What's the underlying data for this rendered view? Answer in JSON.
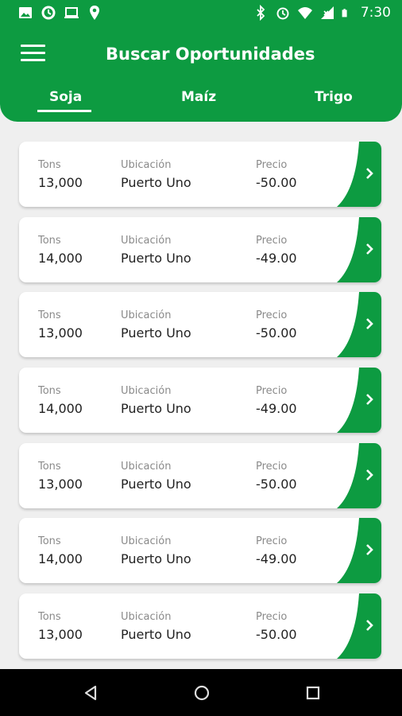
{
  "status_bar": {
    "time": "7:30"
  },
  "header": {
    "title": "Buscar Oportunidades"
  },
  "tabs": [
    {
      "label": "Soja",
      "active": true
    },
    {
      "label": "Maíz",
      "active": false
    },
    {
      "label": "Trigo",
      "active": false
    }
  ],
  "columns": {
    "tons": "Tons",
    "location": "Ubicación",
    "price": "Precio"
  },
  "cards": [
    {
      "tons": "13,000",
      "location": "Puerto Uno",
      "price": "-50.00"
    },
    {
      "tons": "14,000",
      "location": "Puerto Uno",
      "price": "-49.00"
    },
    {
      "tons": "13,000",
      "location": "Puerto Uno",
      "price": "-50.00"
    },
    {
      "tons": "14,000",
      "location": "Puerto Uno",
      "price": "-49.00"
    },
    {
      "tons": "13,000",
      "location": "Puerto Uno",
      "price": "-50.00"
    },
    {
      "tons": "14,000",
      "location": "Puerto Uno",
      "price": "-49.00"
    },
    {
      "tons": "13,000",
      "location": "Puerto Uno",
      "price": "-50.00"
    }
  ],
  "colors": {
    "brand": "#0d9b41",
    "background": "#efefef"
  },
  "icons": [
    "image-icon",
    "sync-icon",
    "laptop-icon",
    "location-pin-icon",
    "bluetooth-icon",
    "alarm-icon",
    "wifi-icon",
    "signal-icon",
    "battery-icon",
    "menu-icon",
    "chevron-right-icon",
    "back-icon",
    "home-icon",
    "recents-icon"
  ]
}
